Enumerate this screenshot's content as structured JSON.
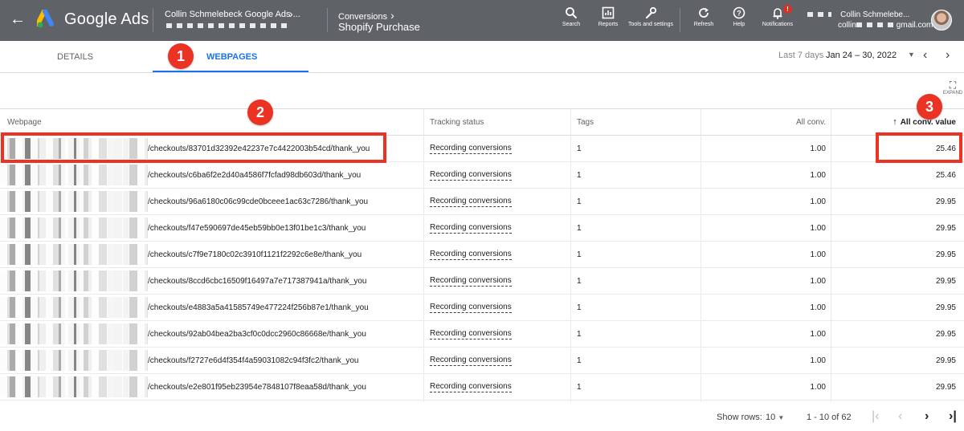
{
  "header": {
    "brand": "Google Ads",
    "account_name": "Collin Schmelebeck Google Ads ...",
    "breadcrumb_parent": "Conversions",
    "breadcrumb_current": "Shopify Purchase",
    "tools": [
      {
        "label": "Search",
        "icon": "search-icon"
      },
      {
        "label": "Reports",
        "icon": "reports-icon"
      },
      {
        "label": "Tools and settings",
        "icon": "wrench-icon"
      },
      {
        "label": "Refresh",
        "icon": "refresh-icon"
      },
      {
        "label": "Help",
        "icon": "help-icon"
      },
      {
        "label": "Notifications",
        "icon": "bell-icon",
        "badge": "!"
      }
    ],
    "user_name": "Collin Schmelebe...",
    "user_email_prefix": "collin",
    "user_email_suffix": "gmail.com"
  },
  "tabs": {
    "details": "DETAILS",
    "webpages": "WEBPAGES",
    "active": "WEBPAGES"
  },
  "date_range": {
    "label": "Last 7 days",
    "value": "Jan 24 – 30, 2022"
  },
  "expand_label": "EXPAND",
  "table": {
    "columns": [
      "Webpage",
      "Tracking status",
      "Tags",
      "All conv.",
      "All conv. value"
    ],
    "sorted_column": "All conv. value",
    "rows": [
      {
        "url": "/checkouts/83701d32392e42237e7c4422003b54cd/thank_you",
        "status": "Recording conversions",
        "tags": "1",
        "all_conv": "1.00",
        "value": "25.46"
      },
      {
        "url": "/checkouts/c6ba6f2e2d40a4586f7fcfad98db603d/thank_you",
        "status": "Recording conversions",
        "tags": "1",
        "all_conv": "1.00",
        "value": "25.46"
      },
      {
        "url": "/checkouts/96a6180c06c99cde0bceee1ac63c7286/thank_you",
        "status": "Recording conversions",
        "tags": "1",
        "all_conv": "1.00",
        "value": "29.95"
      },
      {
        "url": "/checkouts/f47e590697de45eb59bb0e13f01be1c3/thank_you",
        "status": "Recording conversions",
        "tags": "1",
        "all_conv": "1.00",
        "value": "29.95"
      },
      {
        "url": "/checkouts/c7f9e7180c02c3910f1121f2292c6e8e/thank_you",
        "status": "Recording conversions",
        "tags": "1",
        "all_conv": "1.00",
        "value": "29.95"
      },
      {
        "url": "/checkouts/8ccd6cbc16509f16497a7e717387941a/thank_you",
        "status": "Recording conversions",
        "tags": "1",
        "all_conv": "1.00",
        "value": "29.95"
      },
      {
        "url": "/checkouts/e4883a5a41585749e477224f256b87e1/thank_you",
        "status": "Recording conversions",
        "tags": "1",
        "all_conv": "1.00",
        "value": "29.95"
      },
      {
        "url": "/checkouts/92ab04bea2ba3cf0c0dcc2960c86668e/thank_you",
        "status": "Recording conversions",
        "tags": "1",
        "all_conv": "1.00",
        "value": "29.95"
      },
      {
        "url": "/checkouts/f2727e6d4f354f4a59031082c94f3fc2/thank_you",
        "status": "Recording conversions",
        "tags": "1",
        "all_conv": "1.00",
        "value": "29.95"
      },
      {
        "url": "/checkouts/e2e801f95eb23954e7848107f8eaa58d/thank_you",
        "status": "Recording conversions",
        "tags": "1",
        "all_conv": "1.00",
        "value": "29.95"
      }
    ]
  },
  "footer": {
    "show_rows_label": "Show rows:",
    "rows_value": "10",
    "range": "1 - 10 of 62"
  },
  "annotations": [
    "1",
    "2",
    "3"
  ],
  "colors": {
    "topbar": "#5f6368",
    "accent": "#1a73e8",
    "annotation": "#ea3323"
  }
}
